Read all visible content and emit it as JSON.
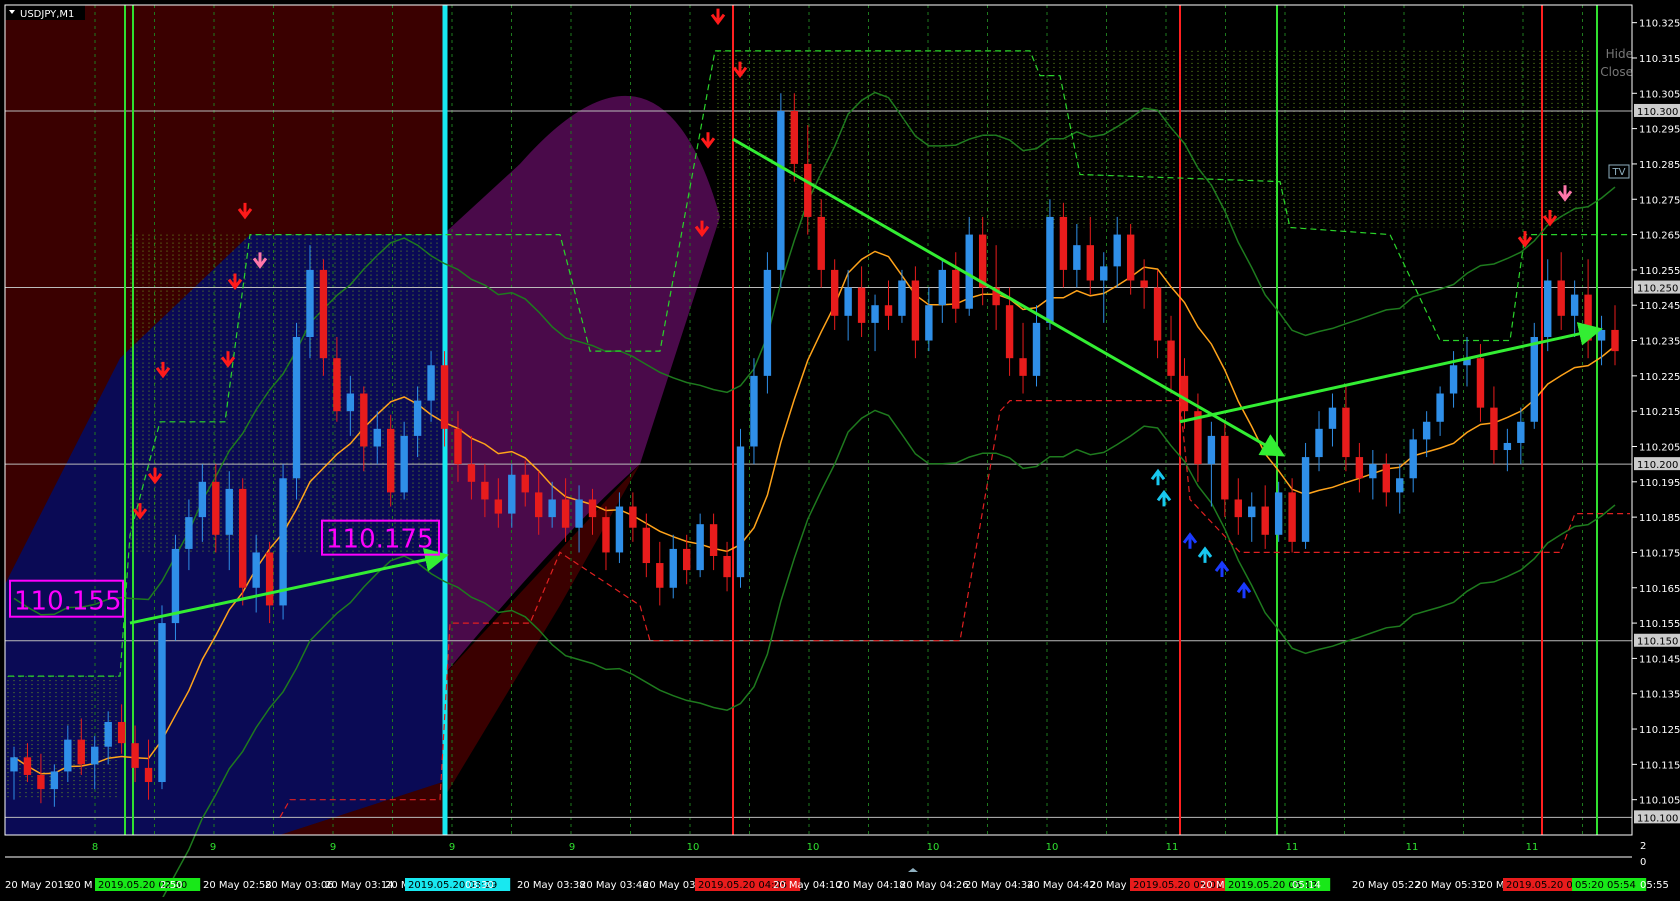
{
  "window": {
    "title": "USDJPY,M1",
    "menu_icon": "triangle-down-icon"
  },
  "controls": {
    "hide": "Hide",
    "close": "Close",
    "tv": "TV"
  },
  "chart_data": {
    "type": "candlestick",
    "symbol": "USDJPY",
    "timeframe": "M1",
    "ylim": [
      110.095,
      110.33
    ],
    "y_ticks": [
      "110.325",
      "110.315",
      "110.305",
      "110.295",
      "110.285",
      "110.275",
      "110.265",
      "110.255",
      "110.245",
      "110.235",
      "110.225",
      "110.215",
      "110.205",
      "110.195",
      "110.185",
      "110.175",
      "110.165",
      "110.155",
      "110.145",
      "110.135",
      "110.125",
      "110.115",
      "110.105"
    ],
    "level_lines": [
      "110.300",
      "110.250",
      "110.200",
      "110.150",
      "110.100"
    ],
    "x_labels": [
      "20 May 2019",
      "20 M",
      "2019.05.20 02:50",
      "2:50",
      "20 May 02:58",
      "20 May 03:06",
      "20 May 03:14",
      "20 M",
      "2019.05.20 03:29",
      "03:30",
      "20 May 03:38",
      "20 May 03:46",
      "20 May 03:",
      "2019.05.20 04:05",
      "20 May 04:10",
      "20 May 04:18",
      "20 May 04:26",
      "20 May 04:34",
      "20 May 04:42",
      "20 May 04:",
      "2019.05.20 05:01",
      "20 M",
      "2019.05.20 05:13",
      "05:14",
      "20 May 05:22",
      "20 May 05:31",
      "20 Ma",
      "2019.05.20 05:47",
      "05:20 05:54",
      "05:55"
    ],
    "indicator_row": [
      "8",
      "9",
      "9",
      "9",
      "9",
      "10",
      "10",
      "10",
      "10",
      "11",
      "11",
      "11",
      "11"
    ],
    "sub_scale": [
      "2",
      "0"
    ],
    "annotations": [
      {
        "text": "110.155",
        "color": "#ff00ff"
      },
      {
        "text": "110.175",
        "color": "#ff00ff"
      }
    ],
    "ohlc": [
      [
        110.113,
        110.12,
        110.105,
        110.117
      ],
      [
        110.117,
        110.121,
        110.11,
        110.112
      ],
      [
        110.112,
        110.118,
        110.104,
        110.108
      ],
      [
        110.108,
        110.115,
        110.103,
        110.113
      ],
      [
        110.113,
        110.126,
        110.11,
        110.122
      ],
      [
        110.122,
        110.128,
        110.112,
        110.115
      ],
      [
        110.115,
        110.123,
        110.108,
        110.12
      ],
      [
        110.12,
        110.13,
        110.115,
        110.127
      ],
      [
        110.127,
        110.132,
        110.118,
        110.121
      ],
      [
        110.121,
        110.126,
        110.11,
        110.114
      ],
      [
        110.114,
        110.122,
        110.105,
        110.11
      ],
      [
        110.11,
        110.16,
        110.108,
        110.155
      ],
      [
        110.155,
        110.18,
        110.15,
        110.176
      ],
      [
        110.176,
        110.19,
        110.17,
        110.185
      ],
      [
        110.185,
        110.2,
        110.178,
        110.195
      ],
      [
        110.195,
        110.2,
        110.175,
        110.18
      ],
      [
        110.18,
        110.198,
        110.17,
        110.193
      ],
      [
        110.193,
        110.196,
        110.16,
        110.165
      ],
      [
        110.165,
        110.18,
        110.158,
        110.175
      ],
      [
        110.175,
        110.178,
        110.155,
        110.16
      ],
      [
        110.16,
        110.2,
        110.156,
        110.196
      ],
      [
        110.196,
        110.24,
        110.19,
        110.236
      ],
      [
        110.236,
        110.262,
        110.23,
        110.255
      ],
      [
        110.255,
        110.258,
        110.225,
        110.23
      ],
      [
        110.23,
        110.236,
        110.212,
        110.215
      ],
      [
        110.215,
        110.225,
        110.208,
        110.22
      ],
      [
        110.22,
        110.222,
        110.198,
        110.205
      ],
      [
        110.205,
        110.215,
        110.2,
        110.21
      ],
      [
        110.21,
        110.214,
        110.188,
        110.192
      ],
      [
        110.192,
        110.212,
        110.19,
        110.208
      ],
      [
        110.208,
        110.222,
        110.202,
        110.218
      ],
      [
        110.218,
        110.232,
        110.212,
        110.228
      ],
      [
        110.228,
        110.232,
        110.205,
        110.21
      ],
      [
        110.21,
        110.215,
        110.195,
        110.2
      ],
      [
        110.2,
        110.208,
        110.19,
        110.195
      ],
      [
        110.195,
        110.2,
        110.185,
        110.19
      ],
      [
        110.19,
        110.196,
        110.182,
        110.186
      ],
      [
        110.186,
        110.2,
        110.182,
        110.197
      ],
      [
        110.197,
        110.201,
        110.188,
        110.192
      ],
      [
        110.192,
        110.198,
        110.18,
        110.185
      ],
      [
        110.185,
        110.195,
        110.182,
        110.19
      ],
      [
        110.19,
        110.196,
        110.178,
        110.182
      ],
      [
        110.182,
        110.194,
        110.175,
        110.19
      ],
      [
        110.19,
        110.193,
        110.18,
        110.185
      ],
      [
        110.185,
        110.188,
        110.17,
        110.175
      ],
      [
        110.175,
        110.192,
        110.172,
        110.188
      ],
      [
        110.188,
        110.192,
        110.178,
        110.182
      ],
      [
        110.182,
        110.186,
        110.168,
        110.172
      ],
      [
        110.172,
        110.178,
        110.16,
        110.165
      ],
      [
        110.165,
        110.18,
        110.162,
        110.176
      ],
      [
        110.176,
        110.18,
        110.166,
        110.17
      ],
      [
        110.17,
        110.186,
        110.168,
        110.183
      ],
      [
        110.183,
        110.186,
        110.17,
        110.174
      ],
      [
        110.174,
        110.178,
        110.164,
        110.168
      ],
      [
        110.168,
        110.21,
        110.165,
        110.205
      ],
      [
        110.205,
        110.23,
        110.2,
        110.225
      ],
      [
        110.225,
        110.26,
        110.22,
        110.255
      ],
      [
        110.255,
        110.305,
        110.25,
        110.3
      ],
      [
        110.3,
        110.305,
        110.28,
        110.285
      ],
      [
        110.285,
        110.296,
        110.265,
        110.27
      ],
      [
        110.27,
        110.275,
        110.25,
        110.255
      ],
      [
        110.255,
        110.258,
        110.238,
        110.242
      ],
      [
        110.242,
        110.255,
        110.235,
        110.25
      ],
      [
        110.25,
        110.256,
        110.236,
        110.24
      ],
      [
        110.24,
        110.248,
        110.232,
        110.245
      ],
      [
        110.245,
        110.252,
        110.238,
        110.242
      ],
      [
        110.242,
        110.255,
        110.24,
        110.252
      ],
      [
        110.252,
        110.256,
        110.23,
        110.235
      ],
      [
        110.235,
        110.25,
        110.232,
        110.245
      ],
      [
        110.245,
        110.258,
        110.24,
        110.255
      ],
      [
        110.255,
        110.26,
        110.24,
        110.244
      ],
      [
        110.244,
        110.27,
        110.242,
        110.265
      ],
      [
        110.265,
        110.27,
        110.245,
        110.25
      ],
      [
        110.25,
        110.262,
        110.238,
        110.245
      ],
      [
        110.245,
        110.25,
        110.225,
        110.23
      ],
      [
        110.23,
        110.24,
        110.22,
        110.225
      ],
      [
        110.225,
        110.245,
        110.222,
        110.24
      ],
      [
        110.24,
        110.275,
        110.238,
        110.27
      ],
      [
        110.27,
        110.274,
        110.25,
        110.255
      ],
      [
        110.255,
        110.268,
        110.25,
        110.262
      ],
      [
        110.262,
        110.27,
        110.248,
        110.252
      ],
      [
        110.252,
        110.26,
        110.24,
        110.256
      ],
      [
        110.256,
        110.27,
        110.25,
        110.265
      ],
      [
        110.265,
        110.268,
        110.248,
        110.252
      ],
      [
        110.252,
        110.258,
        110.244,
        110.25
      ],
      [
        110.25,
        110.255,
        110.23,
        110.235
      ],
      [
        110.235,
        110.242,
        110.22,
        110.225
      ],
      [
        110.225,
        110.23,
        110.21,
        110.215
      ],
      [
        110.215,
        110.22,
        110.195,
        110.2
      ],
      [
        110.2,
        110.212,
        110.188,
        110.208
      ],
      [
        110.208,
        110.212,
        110.185,
        110.19
      ],
      [
        110.19,
        110.196,
        110.18,
        110.185
      ],
      [
        110.185,
        110.192,
        110.178,
        110.188
      ],
      [
        110.188,
        110.194,
        110.176,
        110.18
      ],
      [
        110.18,
        110.195,
        110.178,
        110.192
      ],
      [
        110.192,
        110.196,
        110.175,
        110.178
      ],
      [
        110.178,
        110.206,
        110.176,
        110.202
      ],
      [
        110.202,
        110.215,
        110.198,
        110.21
      ],
      [
        110.21,
        110.22,
        110.205,
        110.216
      ],
      [
        110.216,
        110.222,
        110.198,
        110.202
      ],
      [
        110.202,
        110.206,
        110.192,
        110.196
      ],
      [
        110.196,
        110.204,
        110.19,
        110.2
      ],
      [
        110.2,
        110.203,
        110.188,
        110.192
      ],
      [
        110.192,
        110.2,
        110.186,
        110.196
      ],
      [
        110.196,
        110.21,
        110.192,
        110.207
      ],
      [
        110.207,
        110.215,
        110.202,
        110.212
      ],
      [
        110.212,
        110.222,
        110.208,
        110.22
      ],
      [
        110.22,
        110.232,
        110.216,
        110.228
      ],
      [
        110.228,
        110.236,
        110.222,
        110.23
      ],
      [
        110.23,
        110.234,
        110.212,
        110.216
      ],
      [
        110.216,
        110.222,
        110.2,
        110.204
      ],
      [
        110.204,
        110.21,
        110.198,
        110.206
      ],
      [
        110.206,
        110.216,
        110.2,
        110.212
      ],
      [
        110.212,
        110.24,
        110.21,
        110.236
      ],
      [
        110.236,
        110.258,
        110.232,
        110.252
      ],
      [
        110.252,
        110.26,
        110.238,
        110.242
      ],
      [
        110.242,
        110.252,
        110.236,
        110.248
      ],
      [
        110.248,
        110.258,
        110.23,
        110.235
      ],
      [
        110.235,
        110.242,
        110.228,
        110.238
      ],
      [
        110.238,
        110.245,
        110.228,
        110.232
      ]
    ],
    "series": [
      {
        "kind": "moving-average",
        "color": "#ffa31a"
      },
      {
        "kind": "bollinger-upper",
        "color": "#1a8c1a"
      },
      {
        "kind": "bollinger-lower",
        "color": "#1a8c1a"
      },
      {
        "kind": "resistance-dashed",
        "color": "#2ad42a"
      },
      {
        "kind": "support-dashed",
        "color": "#e02020"
      }
    ],
    "trend_arrows": [
      "up",
      "down",
      "up",
      "up"
    ],
    "colors": {
      "bull": "#2f8fe8",
      "bear": "#e81c1c",
      "grid": "#1e7a1e",
      "axis_text": "#ffffff",
      "zone_red": "#3a0000",
      "zone_blue": "#0a0a55",
      "zone_purple": "#4a0a4a",
      "vline_red": "#ff2020",
      "vline_green": "#30e030",
      "vline_cyan": "#18e8f0"
    }
  }
}
